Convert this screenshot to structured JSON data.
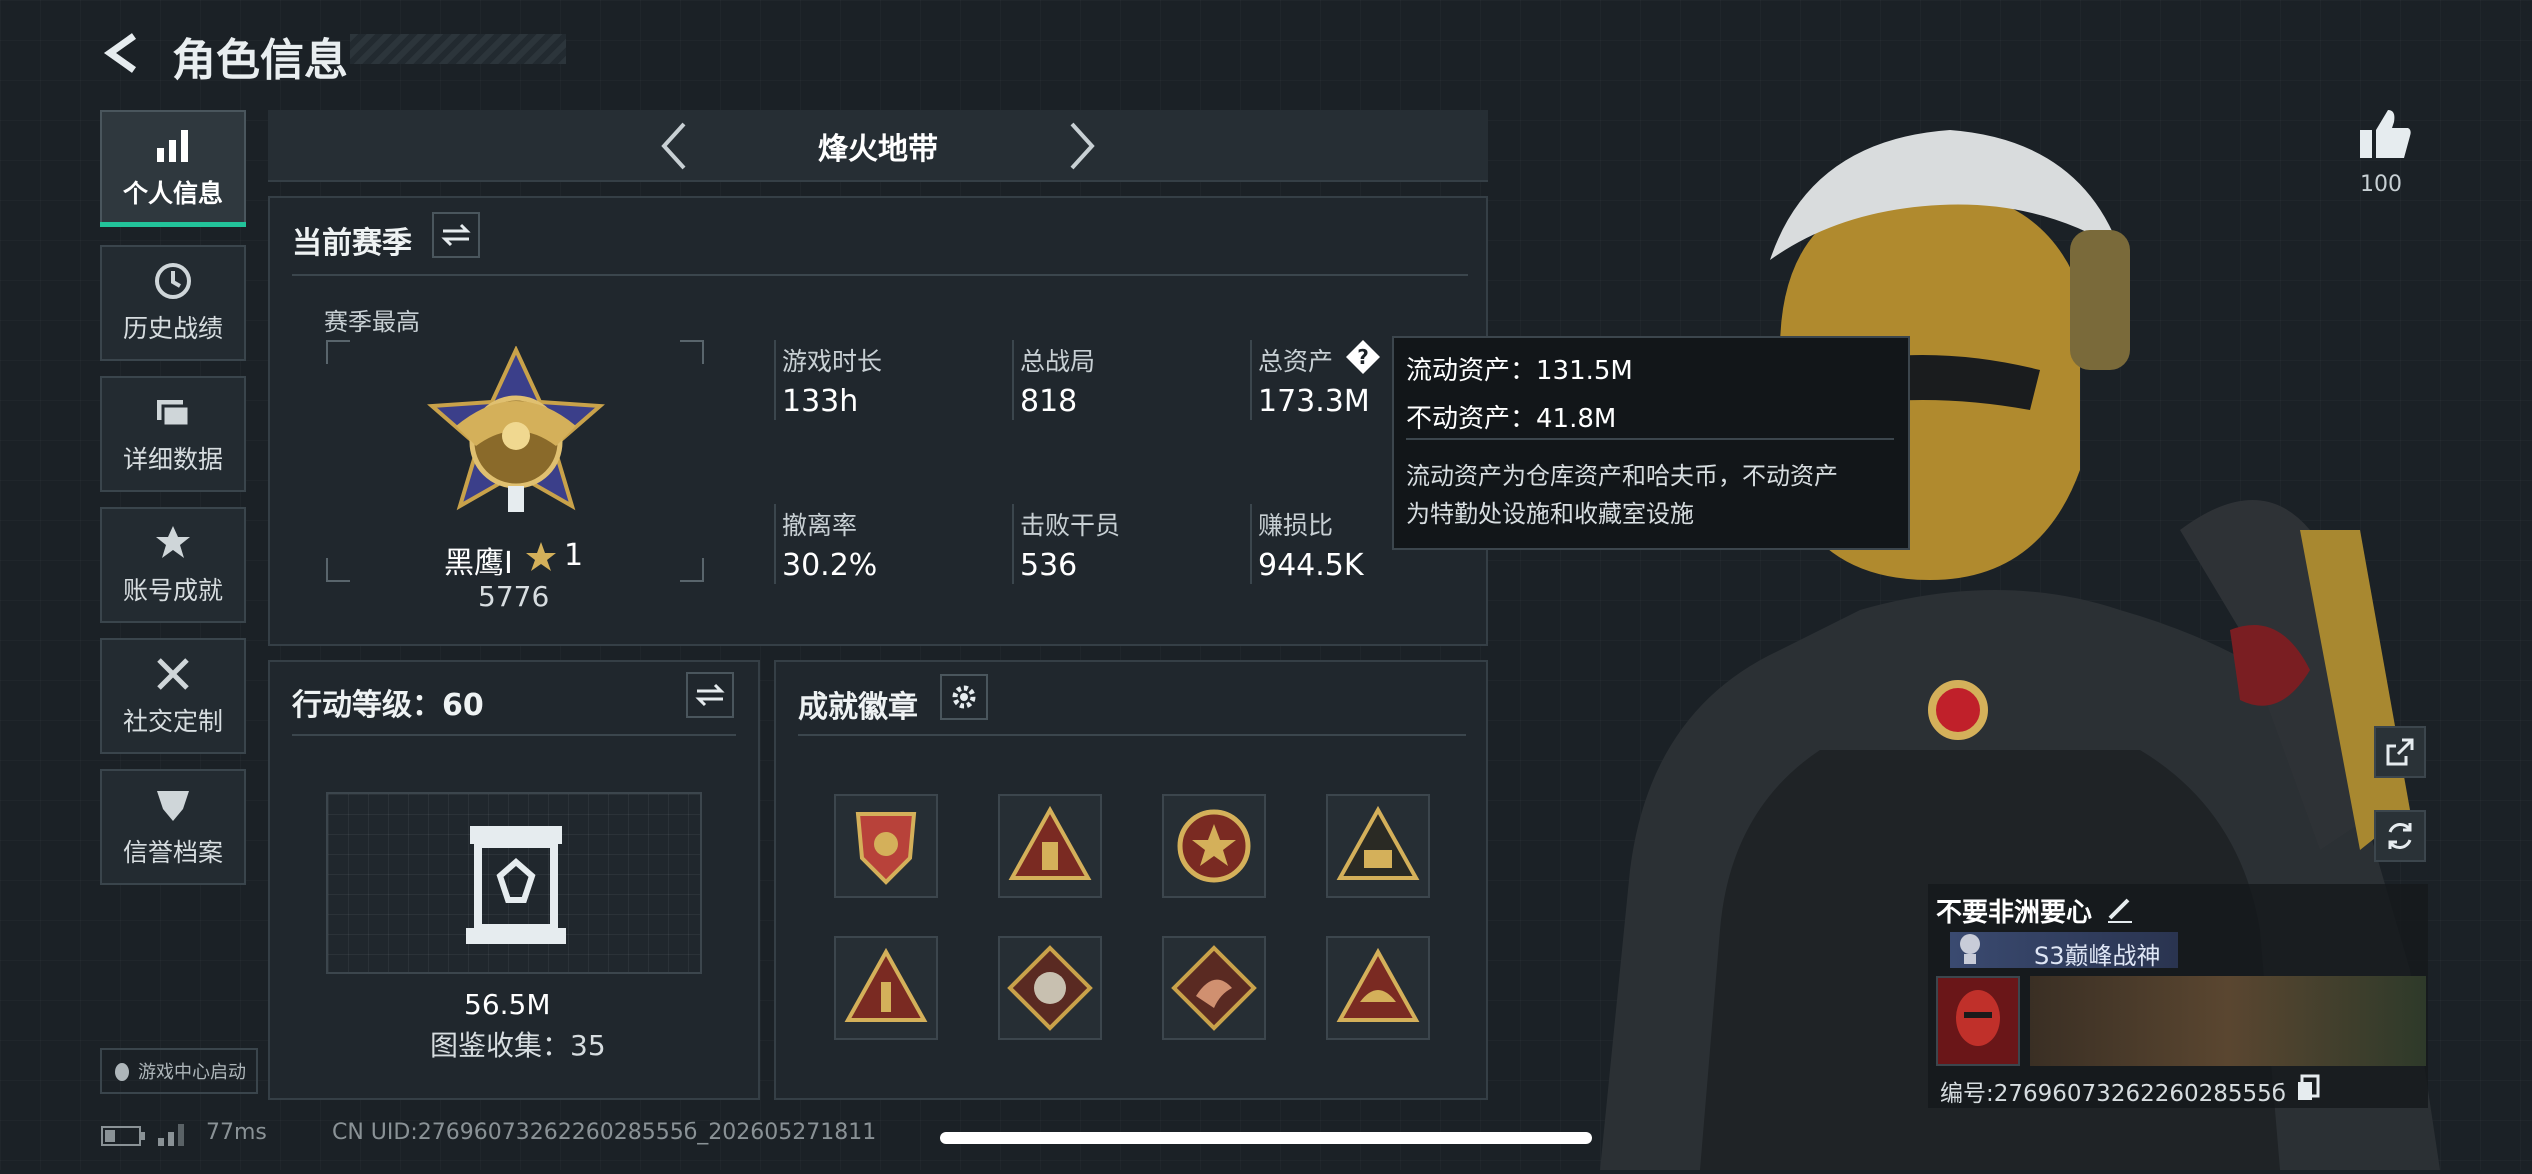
{
  "header": {
    "title": "角色信息"
  },
  "sidebar": {
    "items": [
      {
        "label": "个人信息",
        "icon": "bar-chart-icon",
        "active": true
      },
      {
        "label": "历史战绩",
        "icon": "clock-icon"
      },
      {
        "label": "详细数据",
        "icon": "folder-icon"
      },
      {
        "label": "账号成就",
        "icon": "medal-icon"
      },
      {
        "label": "社交定制",
        "icon": "tools-icon"
      },
      {
        "label": "信誉档案",
        "icon": "shield-icon"
      }
    ],
    "game_center": "游戏中心启动"
  },
  "mode_switcher": {
    "title": "烽火地带"
  },
  "season": {
    "title": "当前赛季",
    "best_label": "赛季最高",
    "rank_name": "黑鹰I",
    "rank_stars": "1",
    "rank_points": "5776",
    "stats": [
      {
        "label": "游戏时长",
        "value": "133h"
      },
      {
        "label": "总战局",
        "value": "818"
      },
      {
        "label": "总资产",
        "value": "173.3M"
      },
      {
        "label": "撤离率",
        "value": "30.2%"
      },
      {
        "label": "击败干员",
        "value": "536"
      },
      {
        "label": "赚损比",
        "value": "944.5K"
      }
    ]
  },
  "tooltip": {
    "liquid": "流动资产：131.5M",
    "fixed": "不动资产：41.8M",
    "desc_line1": "流动资产为仓库资产和哈夫币，不动资产",
    "desc_line2": "为特勤处设施和收藏室设施"
  },
  "action_level": {
    "title": "行动等级：60",
    "value": "56.5M",
    "collection": "图鉴收集：35"
  },
  "achievements": {
    "title": "成就徽章",
    "badges": [
      "badge-shield-stars-icon",
      "badge-triangle-tower-icon",
      "badge-star-circle-icon",
      "badge-triangle-chest-icon",
      "badge-triangle-one-icon",
      "badge-wolf-diamond-icon",
      "badge-dragon-diamond-icon",
      "badge-triangle-sun-icon"
    ]
  },
  "likes": {
    "count": "100"
  },
  "profile": {
    "nickname": "不要非洲要心",
    "title_badge": "S3巅峰战神",
    "id_label": "编号:2769607326226028555б"
  },
  "footer": {
    "ping": "77ms",
    "uid": "CN UID:2769607326226028555б_202605271811"
  },
  "colors": {
    "accent": "#22c39a",
    "gold": "#c9a24a",
    "panel": "#20272d",
    "background": "#1b2126"
  }
}
